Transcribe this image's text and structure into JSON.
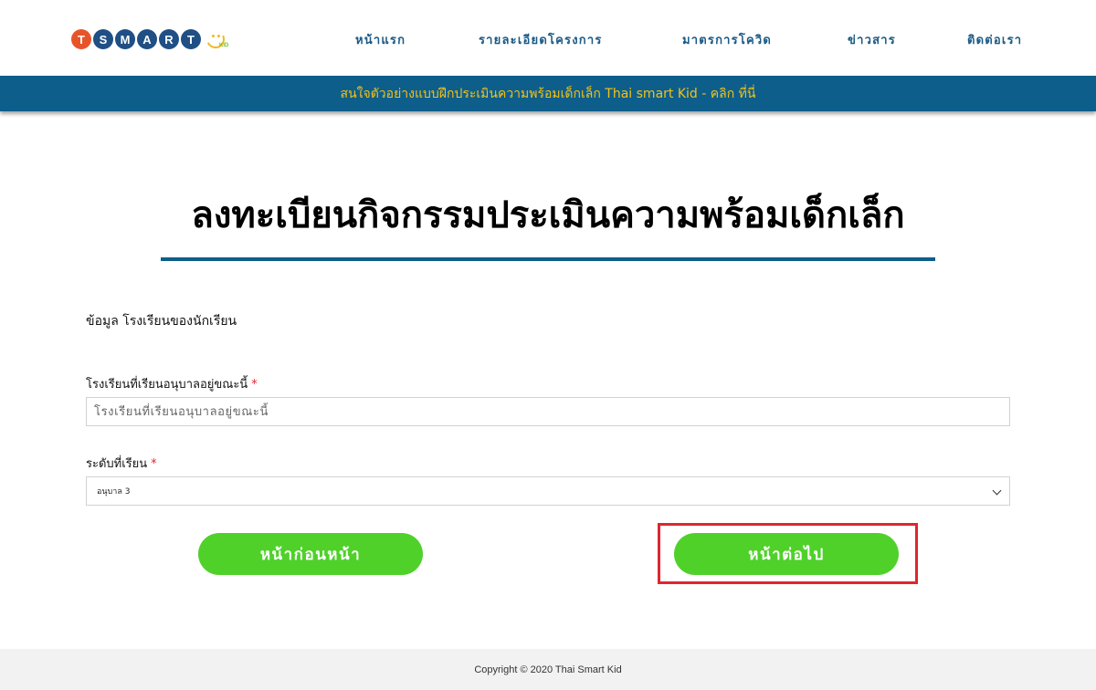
{
  "brand": {
    "logo_letters": [
      "T",
      "S",
      "M",
      "A",
      "R",
      "T"
    ],
    "logo_colors": [
      "#e8542a",
      "#1f4f84",
      "#1f4f84",
      "#1f4f84",
      "#1f4f84",
      "#1f4f84"
    ],
    "logo_sub": "KID"
  },
  "nav": {
    "items": [
      {
        "label": "หน้าแรก"
      },
      {
        "label": "รายละเอียดโครงการ"
      },
      {
        "label": "มาตรการโควิด"
      },
      {
        "label": "ข่าวสาร"
      },
      {
        "label": "ติดต่อเรา"
      }
    ]
  },
  "banner": {
    "text": "สนใจตัวอย่างแบบฝึกประเมินความพร้อมเด็กเล็ก Thai smart Kid - คลิก ที่นี่"
  },
  "page": {
    "title": "ลงทะเบียนกิจกรรมประเมินความพร้อมเด็กเล็ก",
    "section_label": "ข้อมูล โรงเรียนของนักเรียน"
  },
  "form": {
    "school": {
      "label": "โรงเรียนที่เรียนอนุบาลอยู่ขณะนี้",
      "required_mark": "*",
      "placeholder": "โรงเรียนที่เรียนอนุบาลอยู่ขณะนี้",
      "value": ""
    },
    "level": {
      "label": "ระดับที่เรียน",
      "required_mark": "*",
      "selected": "อนุบาล 3"
    },
    "prev_label": "หน้าก่อนหน้า",
    "next_label": "หน้าต่อไป"
  },
  "footer": {
    "text": "Copyright © 2020 Thai Smart Kid"
  },
  "colors": {
    "brand_blue": "#0e5e8b",
    "nav_text": "#1b5a86",
    "banner_text": "#f3c316",
    "button_green": "#4fd12a",
    "highlight_red": "#e0262e"
  }
}
